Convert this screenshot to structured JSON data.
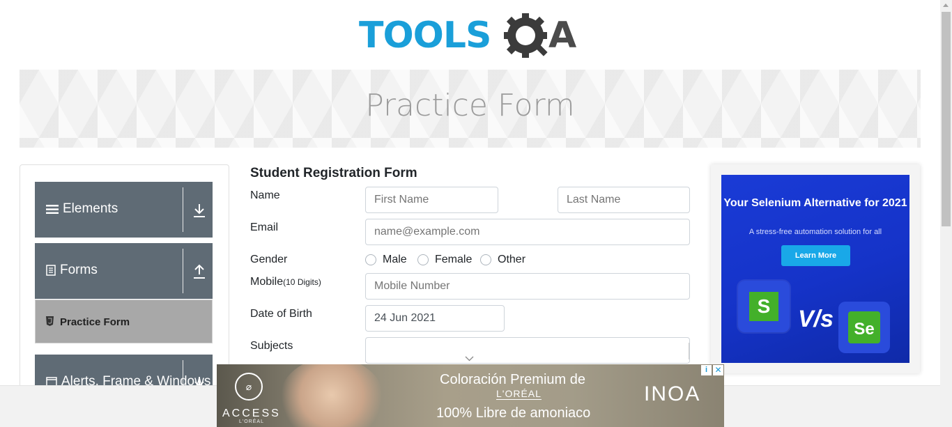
{
  "logo": {
    "text": "TOOLS",
    "suffix": "A"
  },
  "banner": {
    "title": "Practice Form"
  },
  "sidebar": {
    "groups": [
      {
        "label": "Elements",
        "arrow": "down"
      },
      {
        "label": "Forms",
        "arrow": "up"
      },
      {
        "label": "Alerts, Frame & Windows",
        "arrow": "down"
      }
    ],
    "active_item": "Practice Form"
  },
  "form": {
    "title": "Student Registration Form",
    "name_label": "Name",
    "first_name_placeholder": "First Name",
    "last_name_placeholder": "Last Name",
    "email_label": "Email",
    "email_placeholder": "name@example.com",
    "gender_label": "Gender",
    "gender_options": [
      "Male",
      "Female",
      "Other"
    ],
    "mobile_label": "Mobile",
    "mobile_hint": "(10 Digits)",
    "mobile_placeholder": "Mobile Number",
    "dob_label": "Date of Birth",
    "dob_value": "24 Jun 2021",
    "subjects_label": "Subjects"
  },
  "ad_right": {
    "headline": "Your Selenium Alternative for 2021",
    "subline": "A stress-free automation solution for all",
    "button": "Learn More",
    "vs": "V/s",
    "left_tile": "S",
    "right_tile": "Se"
  },
  "ad_bottom": {
    "line1": "Coloración Premium de",
    "brand": "L'ORÉAL",
    "line3": "100% Libre de amoniaco",
    "product": "INOA",
    "left_brand": "ACCESS",
    "left_sub": "L'ORÉAL",
    "close": "✕",
    "info": "i"
  },
  "colors": {
    "accent": "#1a9fd9",
    "sidebar_group": "#5f6b75",
    "sidebar_active": "#a8a8a8",
    "ad_blue": "#1533c8"
  }
}
